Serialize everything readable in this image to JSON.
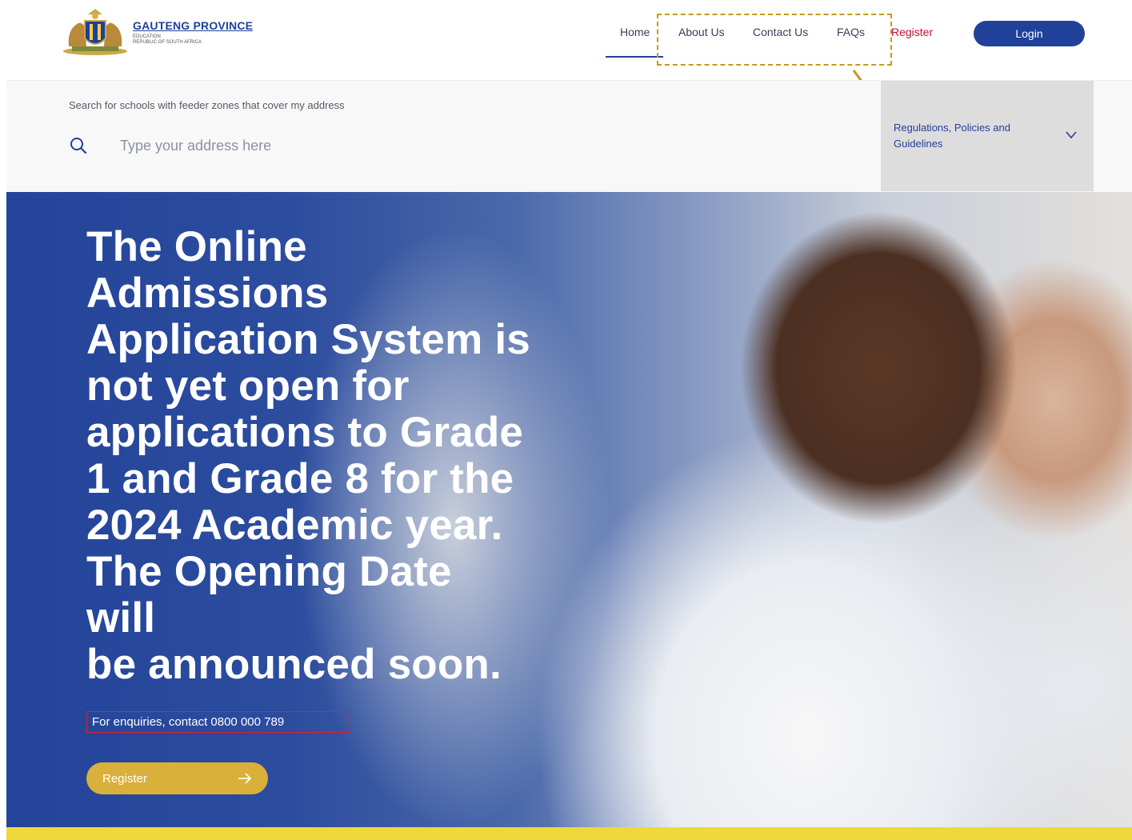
{
  "header": {
    "logo": {
      "title": "GAUTENG PROVINCE",
      "subtitle": "EDUCATION",
      "country": "REPUBLIC OF SOUTH AFRICA",
      "icon": "coat-of-arms-icon"
    },
    "nav": {
      "home": "Home",
      "about": "About Us",
      "contact": "Contact Us",
      "faqs": "FAQs",
      "register": "Register"
    },
    "login_label": "Login"
  },
  "search": {
    "label": "Search for schools with feeder zones that cover my address",
    "placeholder": "Type your address here",
    "value": "",
    "icon": "search-icon"
  },
  "regulations": {
    "label": "Regulations, Policies and Guidelines",
    "icon": "chevron-down-icon"
  },
  "hero": {
    "headline_lines": [
      "The Online",
      "Admissions",
      "Application System is",
      "not yet open for",
      "applications to Grade",
      "1 and Grade 8 for the",
      "2024 Academic year.",
      "The Opening Date",
      "will",
      "be announced soon."
    ],
    "enquiries": "For enquiries, contact 0800 000 789",
    "register_label": "Register",
    "register_icon": "arrow-right-icon"
  },
  "colors": {
    "brand_blue": "#21409a",
    "register_red": "#c8102e",
    "accent_gold": "#d9b03a",
    "annotation_gold": "#c49a17",
    "footer_yellow": "#f0d83a"
  }
}
